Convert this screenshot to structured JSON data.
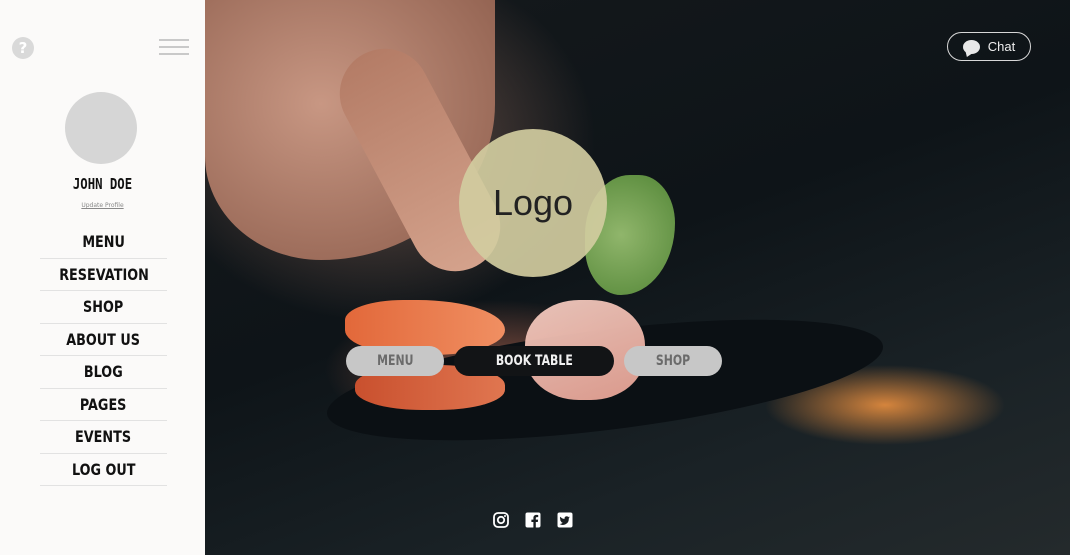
{
  "sidebar": {
    "help_icon": "question-circle-icon",
    "help_glyph": "?",
    "menu_icon": "hamburger-icon",
    "user_name": "JOHN DOE",
    "update_profile": "Update Profile",
    "items": [
      {
        "label": "MENU"
      },
      {
        "label": "RESEVATION"
      },
      {
        "label": "SHOP"
      },
      {
        "label": "ABOUT US"
      },
      {
        "label": "BLOG"
      },
      {
        "label": "PAGES"
      },
      {
        "label": "EVENTS"
      },
      {
        "label": "LOG OUT"
      }
    ]
  },
  "hero": {
    "chat_label": "Chat",
    "chat_icon": "speech-bubble-icon",
    "logo_text": "Logo",
    "buttons": [
      {
        "label": "MENU"
      },
      {
        "label": "BOOK TABLE"
      },
      {
        "label": "SHOP"
      }
    ],
    "social": [
      "instagram-icon",
      "facebook-icon",
      "twitter-icon"
    ]
  },
  "colors": {
    "sidebar_bg": "#fbfaf9",
    "logo_circle": "#d1cca0",
    "cta_dark": "#121416",
    "cta_light": "#c7c7c7",
    "hero_bg": "#0e1418"
  }
}
